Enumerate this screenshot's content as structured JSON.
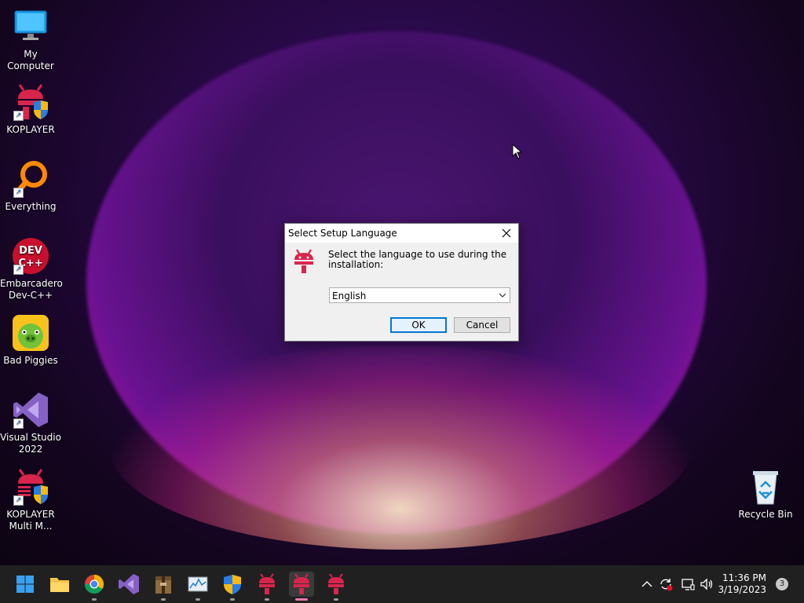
{
  "desktop": {
    "icons": [
      {
        "label": "My Computer",
        "icon": "monitor-icon"
      },
      {
        "label": "KOPLAYER",
        "icon": "koplayer-icon"
      },
      {
        "label": "Everything",
        "icon": "magnifier-icon"
      },
      {
        "label": "Embarcadero Dev-C++",
        "icon": "devcpp-icon",
        "logo_text": "DEV C++"
      },
      {
        "label": "Bad Piggies",
        "icon": "bad-piggies-icon"
      },
      {
        "label": "Visual Studio 2022",
        "icon": "visual-studio-icon"
      },
      {
        "label": "KOPLAYER Multi M...",
        "icon": "koplayer-multi-icon"
      },
      {
        "label": "Recycle Bin",
        "icon": "recycle-bin-icon"
      }
    ]
  },
  "dialog": {
    "title": "Select Setup Language",
    "message": "Select the language to use during the installation:",
    "language_selected": "English",
    "ok_label": "OK",
    "cancel_label": "Cancel"
  },
  "taskbar": {
    "apps": [
      {
        "name": "start",
        "icon": "windows-start-icon"
      },
      {
        "name": "file-explorer",
        "icon": "folder-icon"
      },
      {
        "name": "chrome",
        "icon": "chrome-icon"
      },
      {
        "name": "visual-studio",
        "icon": "visual-studio-icon"
      },
      {
        "name": "archive",
        "icon": "archive-icon"
      },
      {
        "name": "monitor",
        "icon": "performance-monitor-icon"
      },
      {
        "name": "security",
        "icon": "uac-shield-icon"
      },
      {
        "name": "koplayer-1",
        "icon": "koplayer-icon"
      },
      {
        "name": "koplayer-2",
        "icon": "koplayer-icon"
      },
      {
        "name": "koplayer-3",
        "icon": "koplayer-icon"
      }
    ],
    "clock_time": "11:36 PM",
    "clock_date": "3/19/2023",
    "notification_count": "3"
  },
  "colors": {
    "accent": "#0078d7",
    "koplayer": "#d8254c",
    "taskbar": "#202020"
  }
}
